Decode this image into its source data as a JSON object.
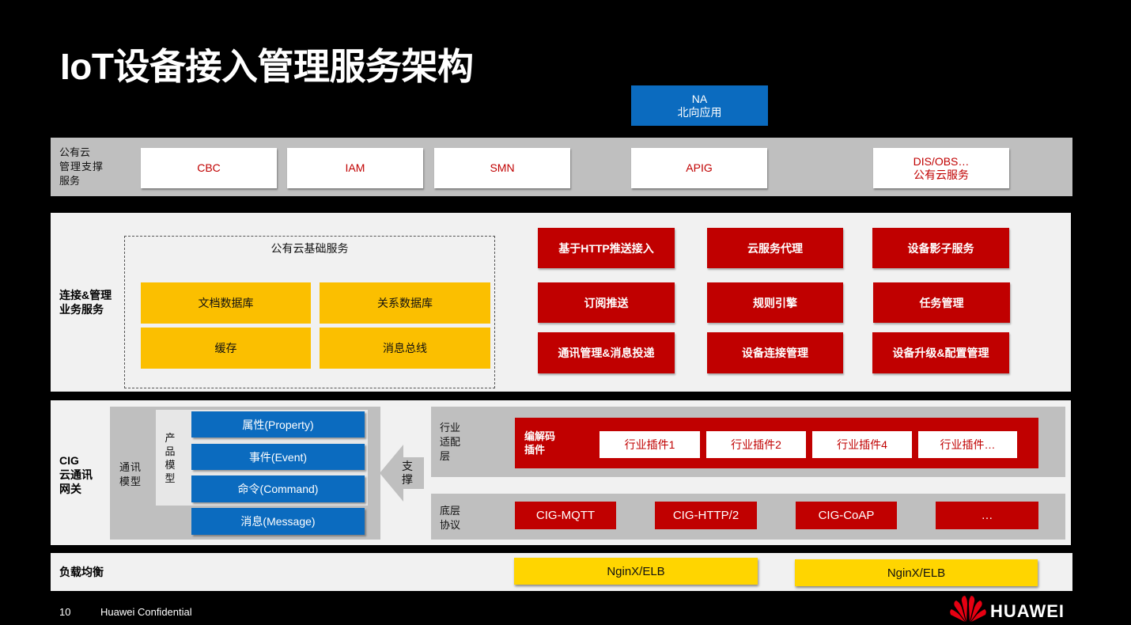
{
  "title": "IoT设备接入管理服务架构",
  "na": {
    "line1": "NA",
    "line2": "北向应用"
  },
  "public_cloud": {
    "label": [
      "公有云",
      "管理支撑",
      "服务"
    ],
    "items": [
      {
        "line1": "CBC",
        "line2": ""
      },
      {
        "line1": "IAM",
        "line2": ""
      },
      {
        "line1": "SMN",
        "line2": ""
      },
      {
        "line1": "APIG",
        "line2": ""
      },
      {
        "line1": "DIS/OBS…",
        "line2": "公有云服务"
      }
    ]
  },
  "connect_mgmt": {
    "label": [
      "连接&管理",
      "业务服务"
    ],
    "infra_title": "公有云基础服务",
    "infra_items": [
      "文档数据库",
      "关系数据库",
      "缓存",
      "消息总线"
    ],
    "red_items": [
      "基于HTTP推送接入",
      "云服务代理",
      "设备影子服务",
      "订阅推送",
      "规则引擎",
      "任务管理",
      "通讯管理&消息投递",
      "设备连接管理",
      "设备升级&配置管理"
    ]
  },
  "cig": {
    "label": [
      "CIG",
      "云通讯",
      "网关"
    ],
    "comm_model": [
      "通讯",
      "模型"
    ],
    "product_model": [
      "产",
      "品",
      "模",
      "型"
    ],
    "model_items": [
      "属性(Property)",
      "事件(Event)",
      "命令(Command)",
      "消息(Message)"
    ],
    "support": [
      "支",
      "撑"
    ],
    "industry_label": [
      "行业",
      "适配",
      "层"
    ],
    "codec_label": [
      "编解码",
      "插件"
    ],
    "plugins": [
      "行业插件1",
      "行业插件2",
      "行业插件4",
      "行业插件…"
    ],
    "protocol_label": [
      "底层",
      "协议"
    ],
    "protocols": [
      "CIG-MQTT",
      "CIG-HTTP/2",
      "CIG-CoAP",
      "…"
    ]
  },
  "load_balance": {
    "label": "负载均衡",
    "items": [
      "NginX/ELB",
      "NginX/ELB"
    ]
  },
  "footer": {
    "page_number": "10",
    "confidential": "Huawei Confidential",
    "brand": "HUAWEI"
  },
  "colors": {
    "red": "#c00000",
    "blue": "#0b6bbf",
    "yellow": "#fbbf00",
    "lb_yellow": "#ffd500"
  }
}
